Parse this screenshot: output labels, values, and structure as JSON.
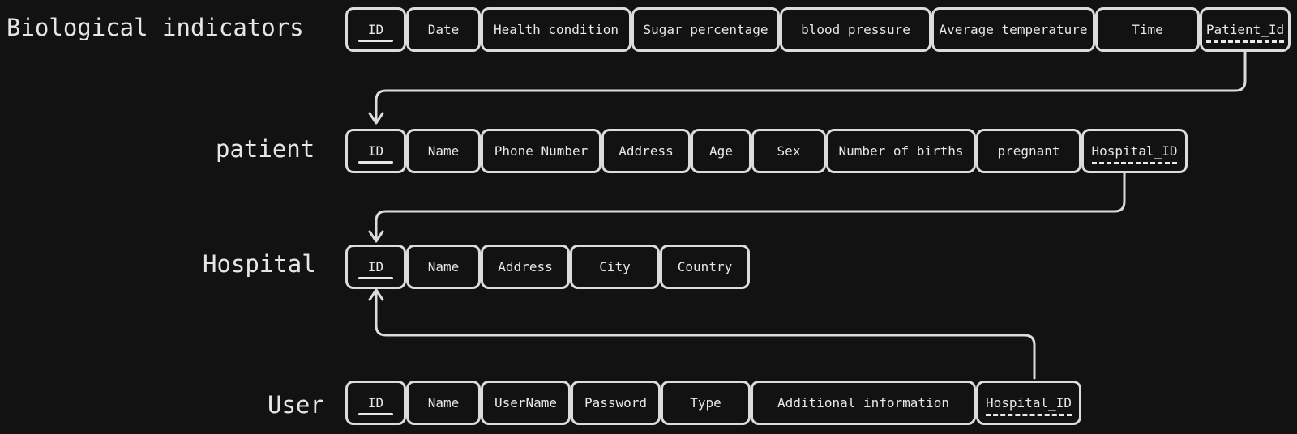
{
  "entities": {
    "biological_indicators": {
      "title": "Biological indicators",
      "attributes": [
        "ID",
        "Date",
        "Health condition",
        "Sugar percentage",
        "blood pressure",
        "Average temperature",
        "Time",
        "Patient_Id"
      ]
    },
    "patient": {
      "title": "patient",
      "attributes": [
        "ID",
        "Name",
        "Phone Number",
        "Address",
        "Age",
        "Sex",
        "Number of births",
        "pregnant",
        "Hospital_ID"
      ]
    },
    "hospital": {
      "title": "Hospital",
      "attributes": [
        "ID",
        "Name",
        "Address",
        "City",
        "Country"
      ]
    },
    "user": {
      "title": "User",
      "attributes": [
        "ID",
        "Name",
        "UserName",
        "Password",
        "Type",
        "Additional information",
        "Hospital_ID"
      ]
    }
  },
  "colors": {
    "background": "#121212",
    "stroke": "#dcdcdc",
    "text": "#e8e8e8"
  }
}
